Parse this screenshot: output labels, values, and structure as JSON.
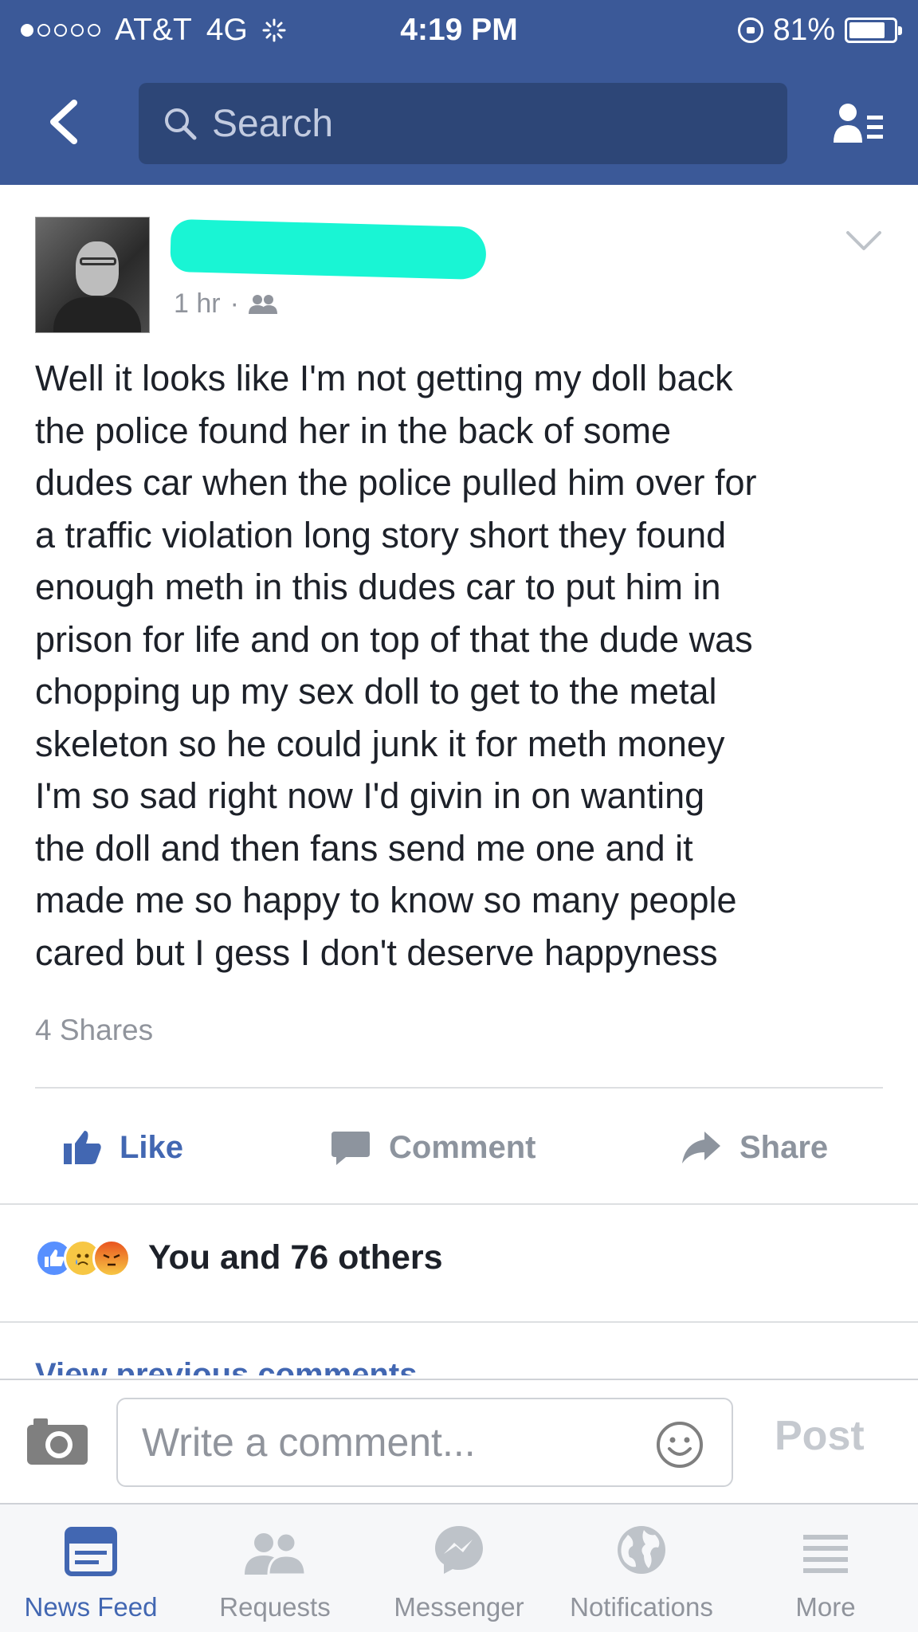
{
  "status_bar": {
    "carrier": "AT&T",
    "network": "4G",
    "time": "4:19 PM",
    "battery": "81%",
    "battery_level": 0.81
  },
  "nav": {
    "search_placeholder": "Search"
  },
  "post": {
    "timestamp": "1 hr",
    "separator": "·",
    "body": "Well it looks like I'm not getting my doll back\nthe police found her in the back of some\ndudes car when the police pulled him over for\na traffic violation long story short they found\nenough meth in this dudes car to put him  in\nprison for life and on top of that the dude was\nchopping up my sex doll to get to the metal\nskeleton so he could junk it for meth money\nI'm so sad right now I'd givin in on wanting\nthe doll and then fans send me one and it\nmade me so happy to know so many people\ncared but I gess I don't deserve happyness",
    "shares": "4 Shares"
  },
  "actions": {
    "like": "Like",
    "comment": "Comment",
    "share": "Share"
  },
  "reactions": {
    "summary": "You and 76 others",
    "icons": [
      "like-reaction-icon",
      "sad-reaction-icon",
      "angry-reaction-icon"
    ]
  },
  "comments": {
    "view_previous": "View previous comments"
  },
  "composer": {
    "placeholder": "Write a comment...",
    "post_label": "Post"
  },
  "tabbar": {
    "tabs": [
      {
        "label": "News Feed",
        "icon": "news-feed-icon",
        "active": true
      },
      {
        "label": "Requests",
        "icon": "friend-requests-icon",
        "active": false
      },
      {
        "label": "Messenger",
        "icon": "messenger-icon",
        "active": false
      },
      {
        "label": "Notifications",
        "icon": "globe-icon",
        "active": false
      },
      {
        "label": "More",
        "icon": "hamburger-icon",
        "active": false
      }
    ]
  },
  "colors": {
    "brand": "#3b5998",
    "accent": "#4267b2",
    "muted": "#90949c",
    "redaction": "#19f5d4"
  }
}
